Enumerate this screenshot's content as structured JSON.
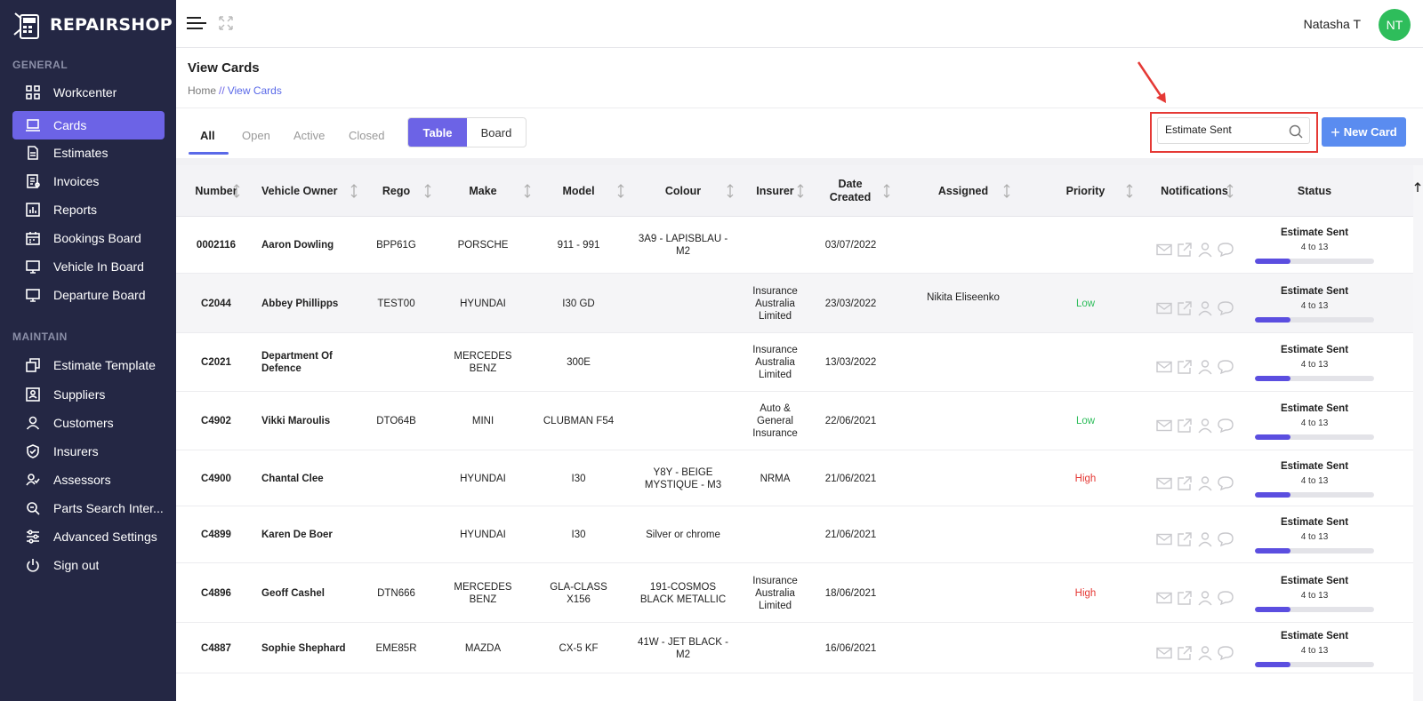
{
  "app": {
    "name": "REPAIRSHOP",
    "user_name": "Natasha T",
    "user_initials": "NT"
  },
  "sidebar": {
    "sections": [
      {
        "label": "GENERAL",
        "items": [
          {
            "label": "Workcenter",
            "icon": "grid-icon"
          },
          {
            "label": "Cards",
            "icon": "laptop-icon",
            "active": true
          },
          {
            "label": "Estimates",
            "icon": "document-icon"
          },
          {
            "label": "Invoices",
            "icon": "invoice-icon"
          },
          {
            "label": "Reports",
            "icon": "chart-icon"
          },
          {
            "label": "Bookings Board",
            "icon": "calendar-icon"
          },
          {
            "label": "Vehicle In Board",
            "icon": "monitor-icon"
          },
          {
            "label": "Departure Board",
            "icon": "monitor-icon"
          }
        ]
      },
      {
        "label": "MAINTAIN",
        "items": [
          {
            "label": "Estimate Template",
            "icon": "copy-icon"
          },
          {
            "label": "Suppliers",
            "icon": "id-badge-icon"
          },
          {
            "label": "Customers",
            "icon": "user-icon"
          },
          {
            "label": "Insurers",
            "icon": "shield-icon"
          },
          {
            "label": "Assessors",
            "icon": "user-check-icon"
          },
          {
            "label": "Parts Search Inter...",
            "icon": "search-doc-icon"
          },
          {
            "label": "Advanced Settings",
            "icon": "sliders-icon"
          },
          {
            "label": "Sign out",
            "icon": "power-icon"
          }
        ]
      }
    ]
  },
  "header": {
    "title": "View Cards",
    "breadcrumb": {
      "home": "Home",
      "separator": "//",
      "current": "View Cards"
    }
  },
  "tabs": [
    {
      "label": "All",
      "active": true
    },
    {
      "label": "Open"
    },
    {
      "label": "Active"
    },
    {
      "label": "Closed"
    }
  ],
  "view_toggle": {
    "table": "Table",
    "board": "Board",
    "selected": "Table"
  },
  "search": {
    "value": "Estimate Sent",
    "placeholder": "Search"
  },
  "new_card_label": "New Card",
  "table": {
    "columns": [
      "Number",
      "Vehicle Owner",
      "Rego",
      "Make",
      "Model",
      "Colour",
      "Insurer",
      "Date Created",
      "Assigned",
      "Priority",
      "Notifications",
      "Status"
    ],
    "rows": [
      {
        "number": "0002116",
        "owner": "Aaron Dowling",
        "rego": "BPP61G",
        "make": "PORSCHE",
        "model": "911 - 991",
        "colour": "3A9 - LAPISBLAU - M2",
        "insurer": "",
        "date": "03/07/2022",
        "assigned": "",
        "priority": "",
        "status": "Estimate Sent",
        "status_sub": "4 to 13",
        "progress": 0.3
      },
      {
        "number": "C2044",
        "owner": "Abbey Phillipps",
        "rego": "TEST00",
        "make": "HYUNDAI",
        "model": "I30 GD",
        "colour": "",
        "insurer": "Insurance Australia Limited",
        "date": "23/03/2022",
        "assigned": "Nikita Eliseenko",
        "priority": "Low",
        "status": "Estimate Sent",
        "status_sub": "4 to 13",
        "progress": 0.3
      },
      {
        "number": "C2021",
        "owner": "Department Of Defence",
        "rego": "",
        "make": "MERCEDES BENZ",
        "model": "300E",
        "colour": "",
        "insurer": "Insurance Australia Limited",
        "date": "13/03/2022",
        "assigned": "",
        "priority": "",
        "status": "Estimate Sent",
        "status_sub": "4 to 13",
        "progress": 0.3
      },
      {
        "number": "C4902",
        "owner": "Vikki Maroulis",
        "rego": "DTO64B",
        "make": "MINI",
        "model": "CLUBMAN F54",
        "colour": "",
        "insurer": "Auto & General Insurance",
        "date": "22/06/2021",
        "assigned": "",
        "priority": "Low",
        "status": "Estimate Sent",
        "status_sub": "4 to 13",
        "progress": 0.3
      },
      {
        "number": "C4900",
        "owner": "Chantal Clee",
        "rego": "",
        "make": "HYUNDAI",
        "model": "I30",
        "colour": "Y8Y - BEIGE MYSTIQUE - M3",
        "insurer": "NRMA",
        "date": "21/06/2021",
        "assigned": "",
        "priority": "High",
        "status": "Estimate Sent",
        "status_sub": "4 to 13",
        "progress": 0.3
      },
      {
        "number": "C4899",
        "owner": "Karen De Boer",
        "rego": "",
        "make": "HYUNDAI",
        "model": "I30",
        "colour": "Silver or chrome",
        "insurer": "",
        "date": "21/06/2021",
        "assigned": "",
        "priority": "",
        "status": "Estimate Sent",
        "status_sub": "4 to 13",
        "progress": 0.3
      },
      {
        "number": "C4896",
        "owner": "Geoff Cashel",
        "rego": "DTN666",
        "make": "MERCEDES BENZ",
        "model": "GLA-CLASS X156",
        "colour": "191-COSMOS BLACK METALLIC",
        "insurer": "Insurance Australia Limited",
        "date": "18/06/2021",
        "assigned": "",
        "priority": "High",
        "status": "Estimate Sent",
        "status_sub": "4 to 13",
        "progress": 0.3
      },
      {
        "number": "C4887",
        "owner": "Sophie Shephard",
        "rego": "EME85R",
        "make": "MAZDA",
        "model": "CX-5 KF",
        "colour": "41W - JET BLACK - M2",
        "insurer": "",
        "date": "16/06/2021",
        "assigned": "",
        "priority": "",
        "status": "Estimate Sent",
        "status_sub": "4 to 13",
        "progress": 0.3
      }
    ]
  },
  "colors": {
    "sidebar_bg": "#242744",
    "accent": "#6c63e6",
    "primary_button": "#5a8cf0",
    "priority_low": "#2ebd5b",
    "priority_high": "#e53935",
    "annotation": "#e53935"
  }
}
